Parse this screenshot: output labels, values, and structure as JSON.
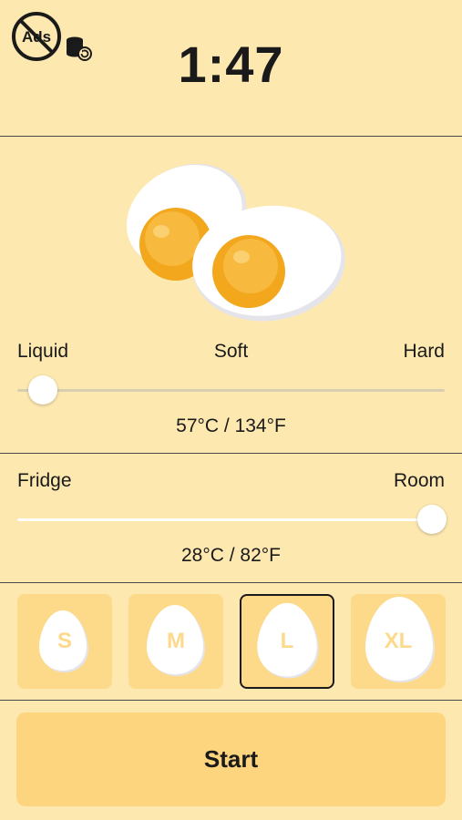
{
  "header": {
    "timer": "1:47",
    "no_ads_label": "Ads"
  },
  "doneness": {
    "labels": {
      "left": "Liquid",
      "center": "Soft",
      "right": "Hard"
    },
    "readout": "57°C / 134°F",
    "level": 0.06
  },
  "start_temp": {
    "labels": {
      "left": "Fridge",
      "right": "Room"
    },
    "readout": "28°C / 82°F",
    "level": 0.97
  },
  "sizes": {
    "items": [
      {
        "label": "S",
        "selected": false
      },
      {
        "label": "M",
        "selected": false
      },
      {
        "label": "L",
        "selected": true
      },
      {
        "label": "XL",
        "selected": false
      }
    ]
  },
  "start": {
    "label": "Start"
  },
  "colors": {
    "background": "#fde8b0",
    "accent": "#fdd57e",
    "yolk": "#f5a623",
    "egg_white": "#ffffff"
  }
}
